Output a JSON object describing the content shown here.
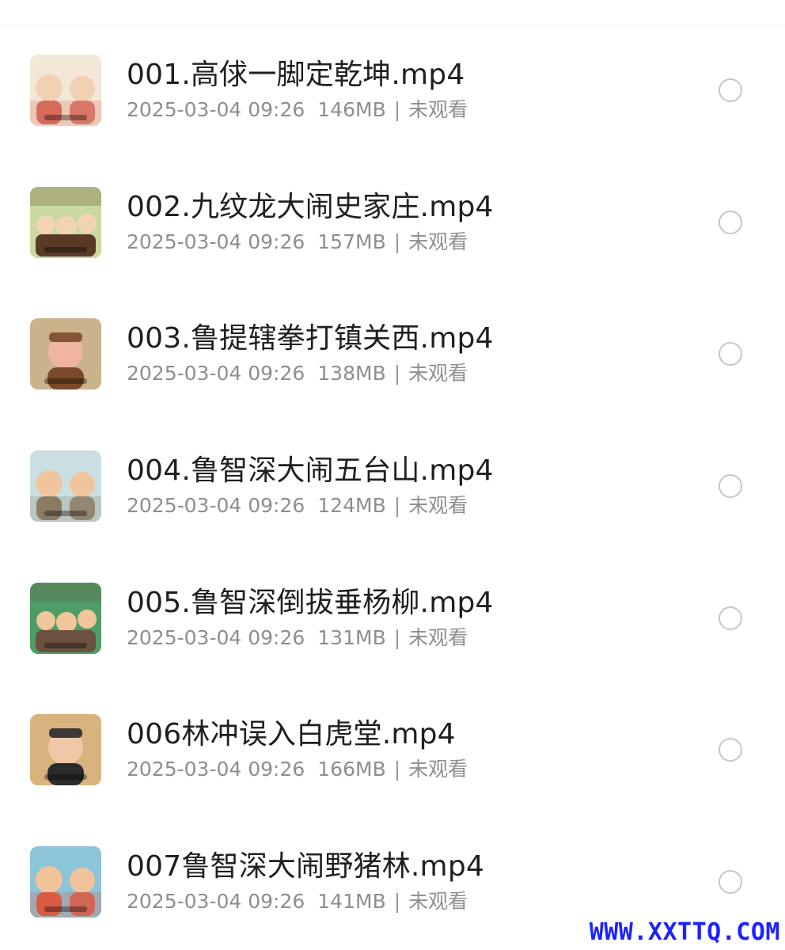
{
  "files": [
    {
      "name": "001.高俅一脚定乾坤.mp4",
      "date": "2025-03-04 09:26",
      "size": "146MB",
      "status": "未观看",
      "thumbnail_colors": [
        "#f3e7d7",
        "#d66a5b",
        "#f2d0b3"
      ]
    },
    {
      "name": "002.九纹龙大闹史家庄.mp4",
      "date": "2025-03-04 09:26",
      "size": "157MB",
      "status": "未观看",
      "thumbnail_colors": [
        "#c9d9a0",
        "#5a3a27",
        "#f3d4b2"
      ]
    },
    {
      "name": "003.鲁提辖拳打镇关西.mp4",
      "date": "2025-03-04 09:26",
      "size": "138MB",
      "status": "未观看",
      "thumbnail_colors": [
        "#c9b28c",
        "#7a4a2a",
        "#eeb4a0"
      ]
    },
    {
      "name": "004.鲁智深大闹五台山.mp4",
      "date": "2025-03-04 09:26",
      "size": "124MB",
      "status": "未观看",
      "thumbnail_colors": [
        "#c9dfe1",
        "#8b7b63",
        "#f0c59e"
      ]
    },
    {
      "name": "005.鲁智深倒拔垂杨柳.mp4",
      "date": "2025-03-04 09:26",
      "size": "131MB",
      "status": "未观看",
      "thumbnail_colors": [
        "#4f9d66",
        "#6b513f",
        "#f0c69a"
      ]
    },
    {
      "name": "006林冲误入白虎堂.mp4",
      "date": "2025-03-04 09:26",
      "size": "166MB",
      "status": "未观看",
      "thumbnail_colors": [
        "#d8b37d",
        "#2b2a2f",
        "#f0c8a8"
      ]
    },
    {
      "name": "007鲁智深大闹野猪林.mp4",
      "date": "2025-03-04 09:26",
      "size": "141MB",
      "status": "未观看",
      "thumbnail_colors": [
        "#8cc4d8",
        "#d95a45",
        "#f0c39a"
      ]
    }
  ],
  "watermark": "WWW.XXTTQ.COM"
}
